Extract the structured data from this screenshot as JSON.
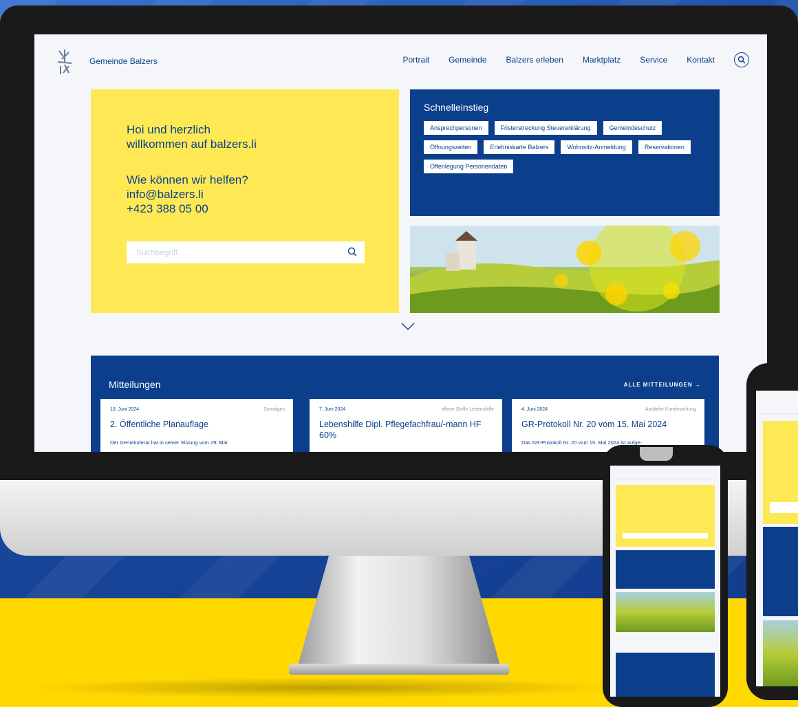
{
  "site": {
    "brand": "Gemeinde Balzers",
    "nav": [
      "Portrait",
      "Gemeinde",
      "Balzers erleben",
      "Marktplatz",
      "Service",
      "Kontakt"
    ]
  },
  "welcome": {
    "line1": "Hoi und herzlich",
    "line2": "willkommen auf balzers.li",
    "line3": "Wie können wir helfen?",
    "email": "info@balzers.li",
    "phone": "+423 388 05 00",
    "search_placeholder": "Suchbegriff"
  },
  "quick": {
    "title": "Schnelleinstieg",
    "chips": [
      "Ansprechpersonen",
      "Fristerstreckung Steuererklärung",
      "Gemeindeschutz",
      "Öffnungszeiten",
      "Erlebniskarte Balzers",
      "Wohnsitz-Anmeldung",
      "Reservationen",
      "Offenlegung Personendaten"
    ]
  },
  "news": {
    "title": "Mitteilungen",
    "all_label": "ALLE MITTEILUNGEN →",
    "items": [
      {
        "date": "10. Juni 2024",
        "category": "Sonstiges",
        "title": "2. Öffentliche Planauflage",
        "snippet": "Der Gemeinderat hat in seiner Sitzung vom 29. Mai"
      },
      {
        "date": "7. Juni 2024",
        "category": "offene Stelle Lebenshilfe",
        "title": "Lebenshilfe Dipl. Pflegefachfrau/-mann HF 60%",
        "snippet": ""
      },
      {
        "date": "4. Juni 2024",
        "category": "Amtliche Kundmachung",
        "title": "GR-Protokoll Nr. 20 vom 15. Mai 2024",
        "snippet": "Das GR-Protokoll Nr. 20 vom 15. Mai 2024 ist aufge-"
      }
    ]
  },
  "colors": {
    "navy": "#0b3f8c",
    "yellow": "#fee955",
    "background": "#f4f6f9"
  }
}
